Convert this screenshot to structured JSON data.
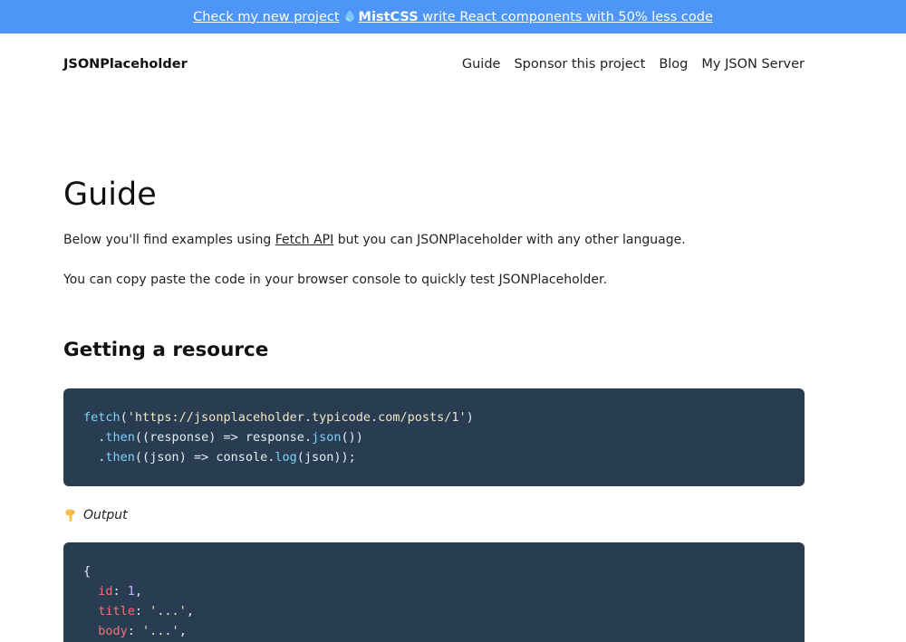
{
  "announcement": {
    "prefix": "Check my new project",
    "brand": "MistCSS",
    "suffix": "write React components with 50% less code"
  },
  "navbar": {
    "brand": "JSONPlaceholder",
    "links": [
      "Guide",
      "Sponsor this project",
      "Blog",
      "My JSON Server"
    ]
  },
  "page": {
    "title": "Guide",
    "intro_before_link": "Below you'll find examples using ",
    "intro_link": "Fetch API",
    "intro_after_link": " but you can JSONPlaceholder with any other language.",
    "copy_paste_text": "You can copy paste the code in your browser console to quickly test JSONPlaceholder."
  },
  "section": {
    "title": "Getting a resource",
    "code": {
      "line1_fn": "fetch",
      "line1_arg": "'https://jsonplaceholder.typicode.com/posts/1'",
      "line2_method": "then",
      "line2_body": "((response) => response.",
      "line2_call": "json",
      "line2_end": "())",
      "line3_method": "then",
      "line3_body": "((json) => console.",
      "line3_call": "log",
      "line3_end": "(json));"
    },
    "output_label": "Output",
    "output": {
      "open": "{",
      "k1": "id",
      "v1": "1",
      "k2": "title",
      "v2": "'...'",
      "k3": "body",
      "v3": "'...'"
    }
  },
  "colors": {
    "announcement_bg": "#4d95f7",
    "code_bg": "#283d52"
  }
}
